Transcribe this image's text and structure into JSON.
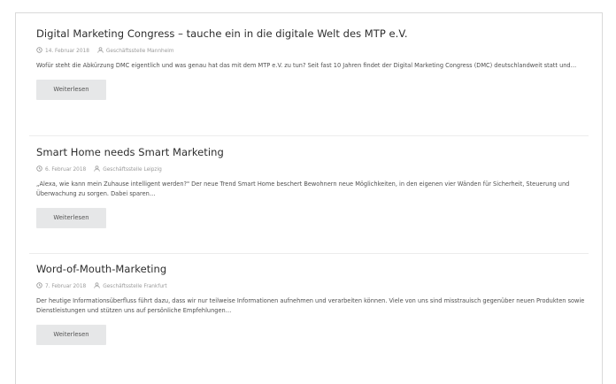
{
  "posts": [
    {
      "title": "Digital Marketing Congress – tauche ein in die digitale Welt des MTP e.V.",
      "date": "14. Februar 2018",
      "author": "Geschäftsstelle Mannheim",
      "excerpt": "Wofür steht die Abkürzung DMC eigentlich und was genau hat das mit dem MTP e.V. zu tun? Seit fast 10 Jahren findet der Digital Marketing Congress (DMC) deutschlandweit statt und…",
      "button": "Weiterlesen"
    },
    {
      "title": "Smart Home needs Smart Marketing",
      "date": "6. Februar 2018",
      "author": "Geschäftsstelle Leipzig",
      "excerpt": "„Alexa, wie kann mein Zuhause intelligent werden?\" Der neue Trend Smart Home beschert Bewohnern neue Möglichkeiten, in den eigenen vier Wänden für Sicherheit, Steuerung und Überwachung zu sorgen. Dabei sparen…",
      "button": "Weiterlesen"
    },
    {
      "title": "Word-of-Mouth-Marketing",
      "date": "7. Februar 2018",
      "author": "Geschäftsstelle Frankfurt",
      "excerpt": "Der heutige Informationsüberfluss führt dazu, dass wir nur teilweise Informationen aufnehmen und verarbeiten können. Viele von uns sind misstrauisch gegenüber neuen Produkten sowie Dienstleistungen und stützen uns auf persönliche Empfehlungen…",
      "button": "Weiterlesen"
    }
  ],
  "icons": {
    "date": "clock-icon",
    "author": "user-icon"
  },
  "colors": {
    "button_bg": "#e6e7e8",
    "title": "#2d2d2d",
    "meta": "#9a9a9a",
    "border": "#d9d9d9"
  }
}
